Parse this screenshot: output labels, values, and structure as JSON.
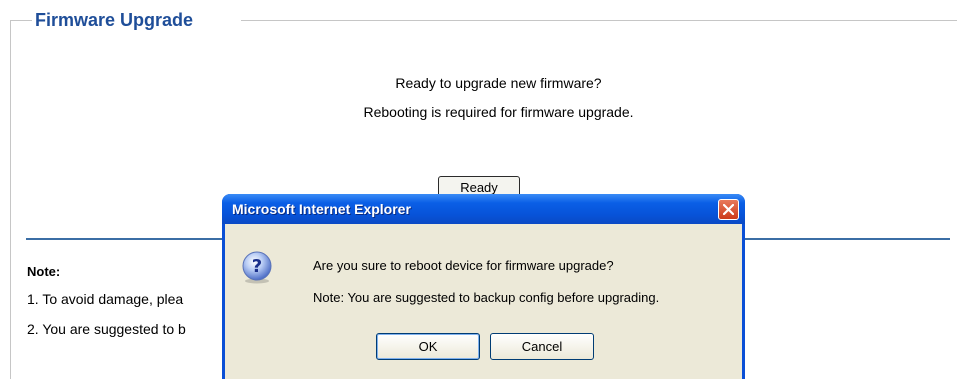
{
  "section": {
    "title": "Firmware Upgrade",
    "message_line1": "Ready to upgrade new firmware?",
    "message_line2": "Rebooting is required for firmware upgrade.",
    "ready_button": "Ready"
  },
  "note": {
    "title": "Note:",
    "items": [
      "1. To avoid damage, plea",
      "2. You are suggested to b"
    ]
  },
  "dialog": {
    "title": "Microsoft Internet Explorer",
    "question": "Are you sure to reboot device for firmware upgrade?",
    "note": "Note: You are suggested to backup config before upgrading.",
    "ok_label": "OK",
    "cancel_label": "Cancel",
    "icon": "question-icon",
    "close_icon": "close-icon"
  },
  "colors": {
    "title_blue": "#1f4e99",
    "divider_blue": "#3b6ea5",
    "dialog_title_blue": "#0753d8",
    "dialog_body": "#ece9d8",
    "close_red": "#cc3a1a"
  }
}
